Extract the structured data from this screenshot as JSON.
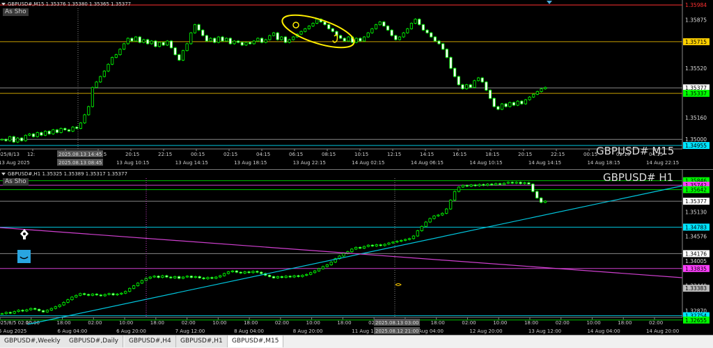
{
  "panes": [
    {
      "id": "m15",
      "header": "GBPUSD#,M15  1.35376 1.35380 1.35365 1.35377",
      "as_show": "As Sho",
      "symbol_label": "GBPUSD# M15",
      "price_min": 1.3494,
      "price_max": 1.36,
      "price_labels": [
        {
          "value": "1.35984",
          "price": 1.35984,
          "color": "#ff3030",
          "bg": "#000",
          "border": "#ff3030"
        },
        {
          "value": "1.35875",
          "price": 1.35875,
          "color": "#ddd",
          "bg": "#000",
          "border": ""
        },
        {
          "value": "1.35715",
          "price": 1.35715,
          "color": "#000",
          "bg": "#ffd000",
          "border": ""
        },
        {
          "value": "1.35520",
          "price": 1.3552,
          "color": "#ddd",
          "bg": "#000",
          "border": ""
        },
        {
          "value": "1.35377",
          "price": 1.35377,
          "color": "#000",
          "bg": "#fff",
          "border": ""
        },
        {
          "value": "1.35337",
          "price": 1.35337,
          "color": "#000",
          "bg": "#00ff00",
          "border": ""
        },
        {
          "value": "1.35160",
          "price": 1.3516,
          "color": "#ddd",
          "bg": "#000",
          "border": ""
        },
        {
          "value": "1.35000",
          "price": 1.35,
          "color": "#ddd",
          "bg": "#000",
          "border": ""
        },
        {
          "value": "1.34955",
          "price": 1.34955,
          "color": "#000",
          "bg": "#00e5ff",
          "border": ""
        }
      ],
      "hlines": [
        {
          "price": 1.35984,
          "color": "#ff3030"
        },
        {
          "price": 1.35715,
          "color": "#c8a000"
        },
        {
          "price": 1.35377,
          "color": "#888888"
        },
        {
          "price": 1.35337,
          "color": "#c8a000"
        },
        {
          "price": 1.35,
          "color": "#888888"
        },
        {
          "price": 1.34955,
          "color": "#00c8e0"
        }
      ],
      "time_labels": [
        "2025/8/13",
        "12:",
        "15",
        "18:15",
        "20:15",
        "22:15",
        "00:15",
        "02:15",
        "04:15",
        "06:15",
        "08:15",
        "10:15",
        "12:15",
        "14:15",
        "16:15",
        "18:15",
        "20:15",
        "22:15",
        "00:15",
        "02:15",
        "04:15"
      ],
      "date_labels": [
        "13 Aug 2025",
        "13",
        "13 Aug 10:15",
        "13 Aug 14:15",
        "13 Aug 18:15",
        "13 Aug 22:15",
        "14 Aug 02:15",
        "14 Aug 06:15",
        "14 Aug 10:15",
        "14 Aug 14:15",
        "14 Aug 18:15",
        "14 Aug 22:15"
      ],
      "crosshair_time": "2025.08.13 14:45",
      "crosshair_date": "2025.08.13 08:45",
      "closes": [
        1.35,
        1.3499,
        1.3502,
        1.3498,
        1.3501,
        1.3499,
        1.3503,
        1.3504,
        1.3502,
        1.3505,
        1.3503,
        1.3506,
        1.3504,
        1.3507,
        1.3505,
        1.3508,
        1.3507,
        1.3506,
        1.3509,
        1.3508,
        1.3512,
        1.3518,
        1.3524,
        1.3538,
        1.3542,
        1.3546,
        1.355,
        1.3555,
        1.356,
        1.3562,
        1.3566,
        1.357,
        1.3574,
        1.3572,
        1.3575,
        1.3571,
        1.3573,
        1.357,
        1.3572,
        1.3568,
        1.3571,
        1.3569,
        1.3572,
        1.3567,
        1.3562,
        1.3558,
        1.3565,
        1.357,
        1.3578,
        1.3584,
        1.358,
        1.3576,
        1.3572,
        1.3574,
        1.3571,
        1.3575,
        1.3572,
        1.3574,
        1.357,
        1.3572,
        1.3571,
        1.3569,
        1.3571,
        1.357,
        1.3572,
        1.3574,
        1.3571,
        1.3573,
        1.3576,
        1.3578,
        1.3573,
        1.3575,
        1.3571,
        1.3573,
        1.3575,
        1.3577,
        1.3579,
        1.3581,
        1.3583,
        1.3585,
        1.3588,
        1.3586,
        1.3584,
        1.3581,
        1.3579,
        1.3576,
        1.3574,
        1.3572,
        1.3575,
        1.3571,
        1.3574,
        1.3572,
        1.3575,
        1.3578,
        1.3581,
        1.3584,
        1.3586,
        1.3583,
        1.358,
        1.3576,
        1.3573,
        1.3575,
        1.3578,
        1.3581,
        1.3585,
        1.3588,
        1.3584,
        1.358,
        1.3578,
        1.3575,
        1.3572,
        1.357,
        1.3566,
        1.356,
        1.3552,
        1.3546,
        1.354,
        1.3537,
        1.354,
        1.3538,
        1.3543,
        1.3545,
        1.3542,
        1.3536,
        1.353,
        1.3524,
        1.3522,
        1.3526,
        1.3524,
        1.3527,
        1.3525,
        1.3528,
        1.3526,
        1.3529,
        1.3531,
        1.3533,
        1.3535,
        1.3537,
        1.3538
      ]
    },
    {
      "id": "h1",
      "header": "GBPUSD#,H1  1.35325 1.35389 1.35317 1.35377",
      "as_show": "As Sho",
      "symbol_label": "GBPUSD# H1",
      "price_min": 1.3262,
      "price_max": 1.36,
      "price_labels": [
        {
          "value": "1.35846",
          "price": 1.35846,
          "color": "#000",
          "bg": "#00ff00",
          "border": ""
        },
        {
          "value": "1.35742",
          "price": 1.35742,
          "color": "#000",
          "bg": "#ff40ff",
          "border": ""
        },
        {
          "value": "1.35642",
          "price": 1.35642,
          "color": "#000",
          "bg": "#00ff00",
          "border": ""
        },
        {
          "value": "1.35377",
          "price": 1.35377,
          "color": "#000",
          "bg": "#fff",
          "border": ""
        },
        {
          "value": "1.35130",
          "price": 1.3513,
          "color": "#ddd",
          "bg": "#000",
          "border": ""
        },
        {
          "value": "1.34783",
          "price": 1.34783,
          "color": "#000",
          "bg": "#00e5ff",
          "border": ""
        },
        {
          "value": "1.34576",
          "price": 1.34576,
          "color": "#ddd",
          "bg": "#000",
          "border": ""
        },
        {
          "value": "1.34176",
          "price": 1.34176,
          "color": "#000",
          "bg": "#fff",
          "border": ""
        },
        {
          "value": "1.34005",
          "price": 1.34005,
          "color": "#ddd",
          "bg": "#000",
          "border": ""
        },
        {
          "value": "1.33835",
          "price": 1.33835,
          "color": "#000",
          "bg": "#ff40ff",
          "border": ""
        },
        {
          "value": "1.33440",
          "price": 1.3344,
          "color": "#ddd",
          "bg": "#000",
          "border": ""
        },
        {
          "value": "1.33383",
          "price": 1.33383,
          "color": "#000",
          "bg": "#bbb",
          "border": ""
        },
        {
          "value": "1.32870",
          "price": 1.3287,
          "color": "#ddd",
          "bg": "#000",
          "border": ""
        },
        {
          "value": "1.32754",
          "price": 1.32754,
          "color": "#000",
          "bg": "#00e5ff",
          "border": ""
        },
        {
          "value": "1.32655",
          "price": 1.32655,
          "color": "#000",
          "bg": "#00ff00",
          "border": ""
        }
      ],
      "hlines": [
        {
          "price": 1.35846,
          "color": "#00c000"
        },
        {
          "price": 1.35742,
          "color": "#d040d0"
        },
        {
          "price": 1.35642,
          "color": "#00c000"
        },
        {
          "price": 1.35377,
          "color": "#888888"
        },
        {
          "price": 1.34783,
          "color": "#00c8e0"
        },
        {
          "price": 1.34176,
          "color": "#888888"
        },
        {
          "price": 1.33835,
          "color": "#d040d0"
        },
        {
          "price": 1.32754,
          "color": "#00c8e0"
        },
        {
          "price": 1.32655,
          "color": "#00c000"
        }
      ],
      "time_labels": [
        "2025/8/5 02:00",
        "10:00",
        "18:00",
        "02:00",
        "10:00",
        "18:00",
        "02:00",
        "10:00",
        "18:00",
        "02:00",
        "10:00",
        "18:00",
        "02:00",
        "10:00",
        "18:00",
        "02:00",
        "10:00",
        "18:00",
        "02:00",
        "10:00",
        "18:00",
        "02:00"
      ],
      "date_labels": [
        "5 Aug 2025",
        "6 Aug 04:00",
        "6 Aug 20:00",
        "7 Aug 12:00",
        "8 Aug 04:00",
        "8 Aug 20:00",
        "11 Aug 12:00",
        "12 Aug 04:00",
        "12 Aug 20:00",
        "13 Aug 12:00",
        "14 Aug 04:00",
        "14 Aug 20:00"
      ],
      "crosshair_time": "2025.08.13 03:00",
      "crosshair_date": "2025.08.12 21:00",
      "closes": [
        1.328,
        1.3283,
        1.3281,
        1.3285,
        1.3288,
        1.3286,
        1.3289,
        1.3292,
        1.329,
        1.3287,
        1.3284,
        1.3288,
        1.3292,
        1.3296,
        1.33,
        1.3306,
        1.3312,
        1.3318,
        1.3322,
        1.3326,
        1.3324,
        1.3322,
        1.3325,
        1.3323,
        1.3321,
        1.3324,
        1.3326,
        1.3323,
        1.3325,
        1.3327,
        1.3331,
        1.3338,
        1.3344,
        1.335,
        1.3356,
        1.3361,
        1.3364,
        1.3366,
        1.3363,
        1.3367,
        1.3364,
        1.3362,
        1.3365,
        1.3361,
        1.3364,
        1.3366,
        1.3363,
        1.3365,
        1.3362,
        1.336,
        1.3363,
        1.3361,
        1.3364,
        1.3367,
        1.3372,
        1.3376,
        1.3378,
        1.3375,
        1.3373,
        1.3376,
        1.3374,
        1.3377,
        1.3375,
        1.3372,
        1.3368,
        1.3365,
        1.3362,
        1.3365,
        1.3363,
        1.3366,
        1.3364,
        1.3367,
        1.3365,
        1.3368,
        1.337,
        1.3374,
        1.3378,
        1.3383,
        1.3388,
        1.3392,
        1.3398,
        1.3406,
        1.3412,
        1.3418,
        1.3422,
        1.3428,
        1.3432,
        1.343,
        1.3434,
        1.3437,
        1.3435,
        1.3438,
        1.3436,
        1.3439,
        1.3442,
        1.3444,
        1.3446,
        1.3448,
        1.345,
        1.3452,
        1.3458,
        1.347,
        1.348,
        1.349,
        1.3498,
        1.3504,
        1.3506,
        1.351,
        1.352,
        1.354,
        1.356,
        1.357,
        1.3574,
        1.3572,
        1.3575,
        1.3573,
        1.3576,
        1.3574,
        1.3577,
        1.3575,
        1.3578,
        1.3576,
        1.3579,
        1.3581,
        1.3579,
        1.3581,
        1.3578,
        1.358,
        1.3577,
        1.356,
        1.3545,
        1.3535,
        1.3538
      ]
    }
  ],
  "tabs": [
    {
      "label": "GBPUSD#,Weekly",
      "active": false
    },
    {
      "label": "GBPUSD#,Daily",
      "active": false
    },
    {
      "label": "GBPUSD#,H4",
      "active": false
    },
    {
      "label": "GBPUSD#,H1",
      "active": false
    },
    {
      "label": "GBPUSD#,M15",
      "active": true
    }
  ],
  "icons": {
    "pen": "pen-nib-icon",
    "smile": "smile-object-icon",
    "m15_pin": "triangle-marker-icon"
  }
}
